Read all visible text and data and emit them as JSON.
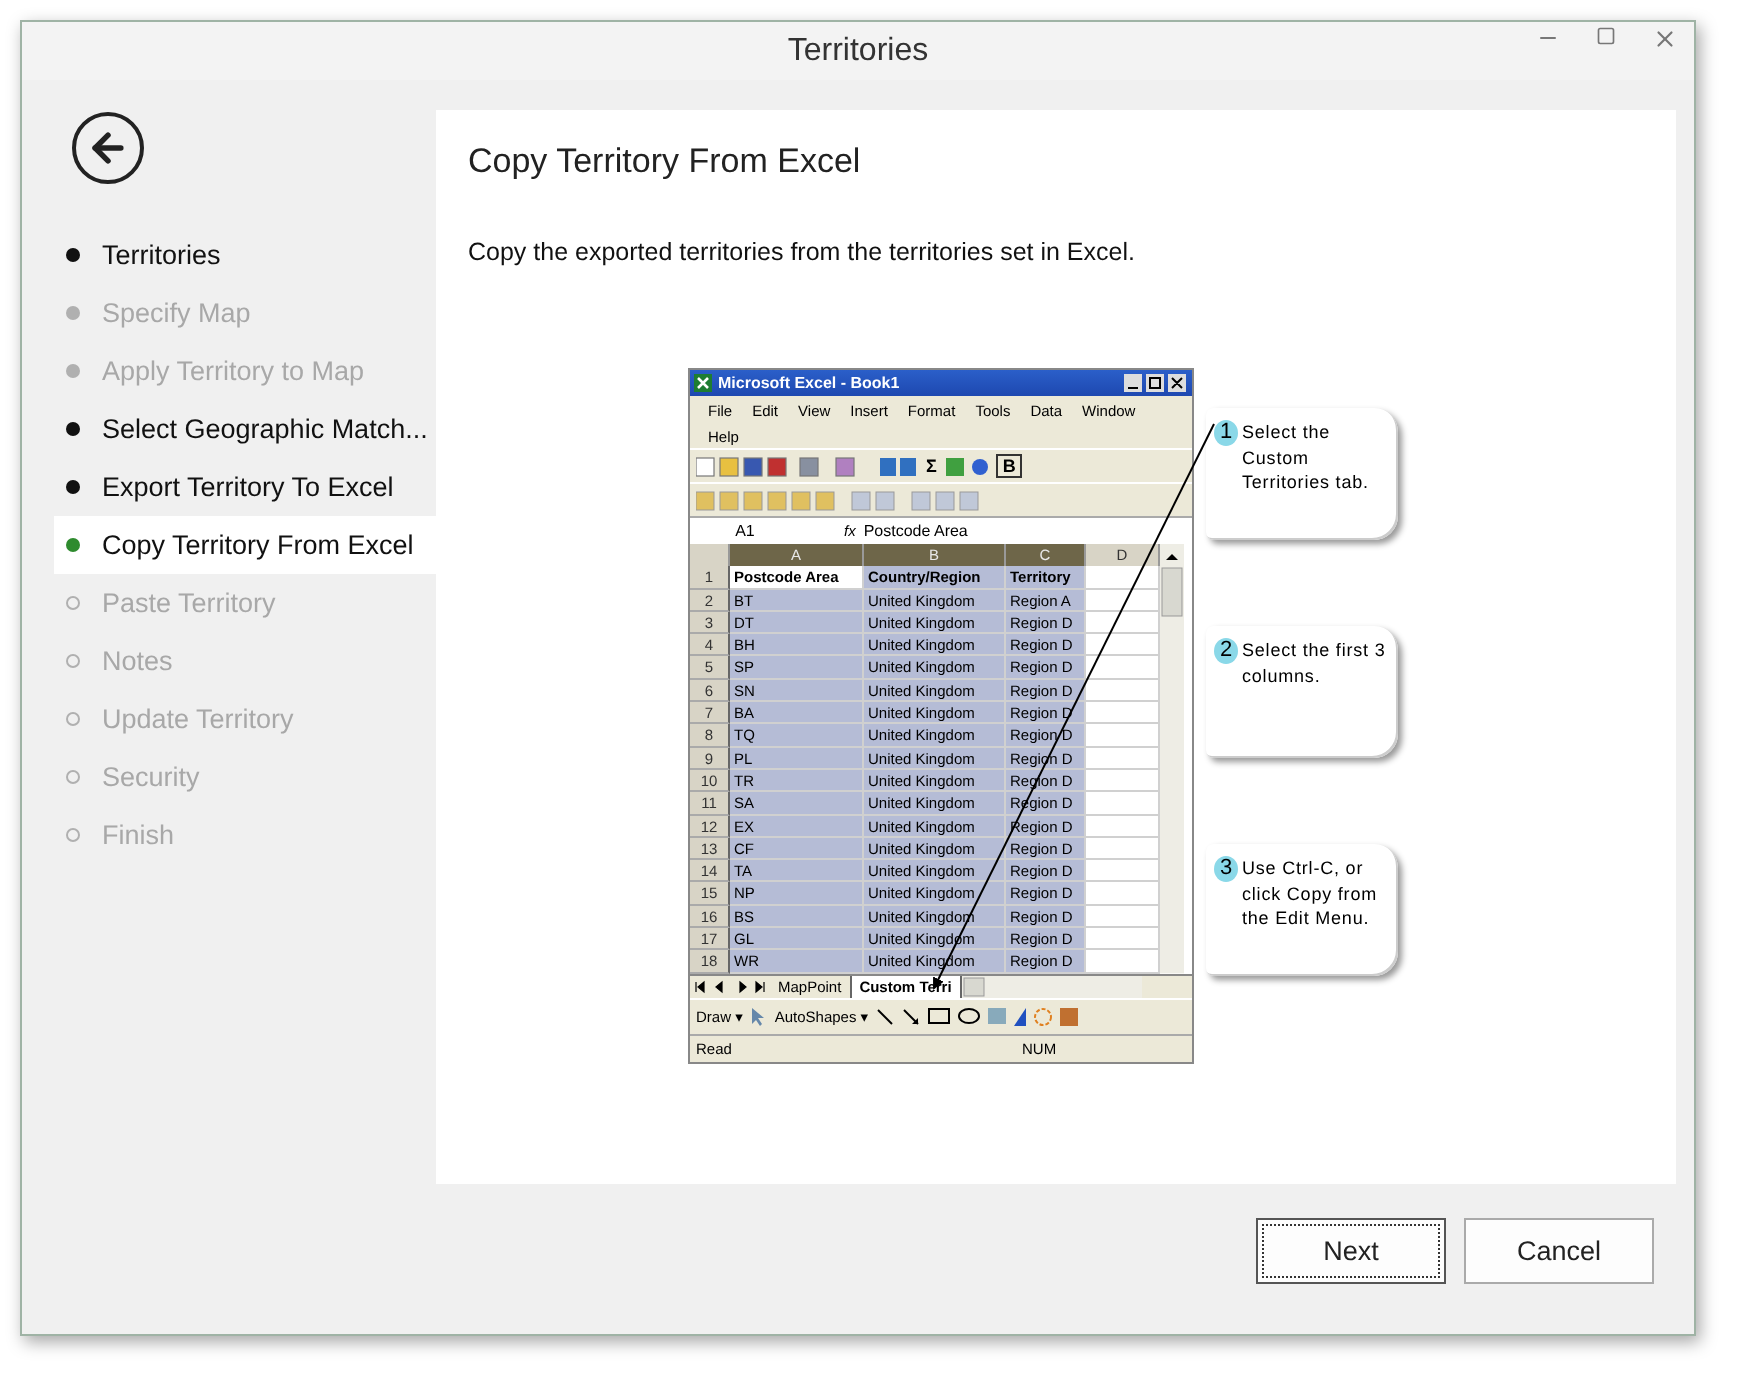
{
  "window": {
    "title": "Territories"
  },
  "sidebar": {
    "steps": [
      {
        "label": "Territories",
        "kind": "done",
        "selected": false
      },
      {
        "label": "Specify Map",
        "kind": "skipped",
        "selected": false
      },
      {
        "label": "Apply Territory to Map",
        "kind": "skipped",
        "selected": false
      },
      {
        "label": "Select Geographic Match...",
        "kind": "done",
        "selected": false
      },
      {
        "label": "Export Territory To Excel",
        "kind": "done",
        "selected": false
      },
      {
        "label": "Copy Territory From Excel",
        "kind": "done",
        "selected": true
      },
      {
        "label": "Paste Territory",
        "kind": "pending",
        "selected": false
      },
      {
        "label": "Notes",
        "kind": "pending",
        "selected": false
      },
      {
        "label": "Update Territory",
        "kind": "pending",
        "selected": false
      },
      {
        "label": "Security",
        "kind": "pending",
        "selected": false
      },
      {
        "label": "Finish",
        "kind": "pending",
        "selected": false
      }
    ]
  },
  "page": {
    "heading": "Copy Territory From Excel",
    "description": "Copy the exported territories from the territories set in Excel."
  },
  "excel": {
    "title": "Microsoft Excel - Book1",
    "menu": [
      "File",
      "Edit",
      "View",
      "Insert",
      "Format",
      "Tools",
      "Data",
      "Window",
      "Help"
    ],
    "toolbar_buttons": [
      "Σ",
      "B"
    ],
    "name_box": "A1",
    "function_label": "fx",
    "formula": "Postcode Area",
    "columns": [
      {
        "label": "A",
        "selected": true
      },
      {
        "label": "B",
        "selected": true
      },
      {
        "label": "C",
        "selected": true
      },
      {
        "label": "D",
        "selected": false
      }
    ],
    "rows": [
      {
        "num": "1",
        "cells": [
          "Postcode Area",
          "Country/Region",
          "Territory"
        ]
      },
      {
        "num": "2",
        "cells": [
          "BT",
          "United Kingdom",
          "Region A"
        ]
      },
      {
        "num": "3",
        "cells": [
          "DT",
          "United Kingdom",
          "Region D"
        ]
      },
      {
        "num": "4",
        "cells": [
          "BH",
          "United Kingdom",
          "Region D"
        ]
      },
      {
        "num": "5",
        "cells": [
          "SP",
          "United Kingdom",
          "Region D"
        ]
      },
      {
        "num": "6",
        "cells": [
          "SN",
          "United Kingdom",
          "Region D"
        ]
      },
      {
        "num": "7",
        "cells": [
          "BA",
          "United Kingdom",
          "Region D"
        ]
      },
      {
        "num": "8",
        "cells": [
          "TQ",
          "United Kingdom",
          "Region D"
        ]
      },
      {
        "num": "9",
        "cells": [
          "PL",
          "United Kingdom",
          "Region D"
        ]
      },
      {
        "num": "10",
        "cells": [
          "TR",
          "United Kingdom",
          "Region D"
        ]
      },
      {
        "num": "11",
        "cells": [
          "SA",
          "United Kingdom",
          "Region D"
        ]
      },
      {
        "num": "12",
        "cells": [
          "EX",
          "United Kingdom",
          "Region D"
        ]
      },
      {
        "num": "13",
        "cells": [
          "CF",
          "United Kingdom",
          "Region D"
        ]
      },
      {
        "num": "14",
        "cells": [
          "TA",
          "United Kingdom",
          "Region D"
        ]
      },
      {
        "num": "15",
        "cells": [
          "NP",
          "United Kingdom",
          "Region D"
        ]
      },
      {
        "num": "16",
        "cells": [
          "BS",
          "United Kingdom",
          "Region D"
        ]
      },
      {
        "num": "17",
        "cells": [
          "GL",
          "United Kingdom",
          "Region D"
        ]
      },
      {
        "num": "18",
        "cells": [
          "WR",
          "United Kingdom",
          "Region D"
        ]
      }
    ],
    "sheet_tabs": [
      {
        "label": "MapPoint",
        "selected": false
      },
      {
        "label": "Custom Terri",
        "selected": true
      }
    ],
    "draw_toolbar": [
      "Draw ▾",
      "AutoShapes ▾"
    ],
    "status": [
      "Read",
      "NUM"
    ]
  },
  "callouts": [
    {
      "number": "1",
      "text": "Select the Custom Territories tab."
    },
    {
      "number": "2",
      "text": "Select the first 3 columns."
    },
    {
      "number": "3",
      "text": "Use Ctrl-C, or click Copy from the Edit Menu."
    }
  ],
  "buttons": [
    {
      "label": "Next",
      "default": true
    },
    {
      "label": "Cancel",
      "default": false
    }
  ]
}
